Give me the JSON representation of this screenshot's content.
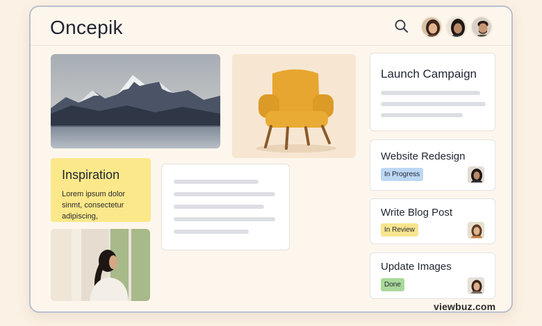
{
  "app": {
    "title": "Oncepik"
  },
  "header": {
    "search_icon": "search-icon",
    "avatars": [
      "avatar-woman-1",
      "avatar-woman-2",
      "avatar-man-1"
    ]
  },
  "sticky_note": {
    "title": "Inspiration",
    "body": "Lorem ipsum dolor sinmt, consectetur adipiscing,"
  },
  "campaign_card": {
    "title": "Launch Campaign"
  },
  "tasks": [
    {
      "title": "Website Redesign",
      "status": "In Progress",
      "status_color": "#bcd7f2"
    },
    {
      "title": "Write Blog Post",
      "status": "In Review",
      "status_color": "#f8e58f"
    },
    {
      "title": "Update Images",
      "status": "Done",
      "status_color": "#a9d99a"
    }
  ],
  "watermark": "viewbuz.com",
  "colors": {
    "background": "#fbf1e4",
    "chair": "#e7a62f",
    "sticky": "#fbe88a"
  }
}
